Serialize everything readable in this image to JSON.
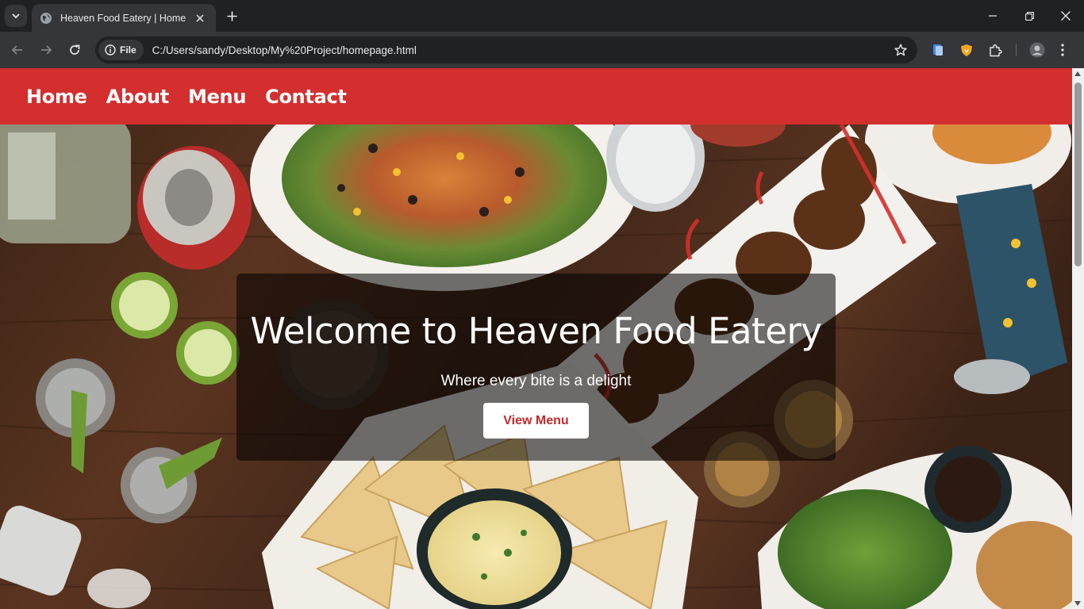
{
  "browser": {
    "tab_title": "Heaven Food Eatery | Home",
    "site_chip_label": "File",
    "url": "C:/Users/sandy/Desktop/My%20Project/homepage.html"
  },
  "site": {
    "nav": [
      "Home",
      "About",
      "Menu",
      "Contact"
    ],
    "hero_title": "Welcome to Heaven Food Eatery",
    "hero_subtitle": "Where every bite is a delight",
    "hero_button": "View Menu",
    "nav_color": "#d32f2f",
    "button_text_color": "#c62828"
  }
}
